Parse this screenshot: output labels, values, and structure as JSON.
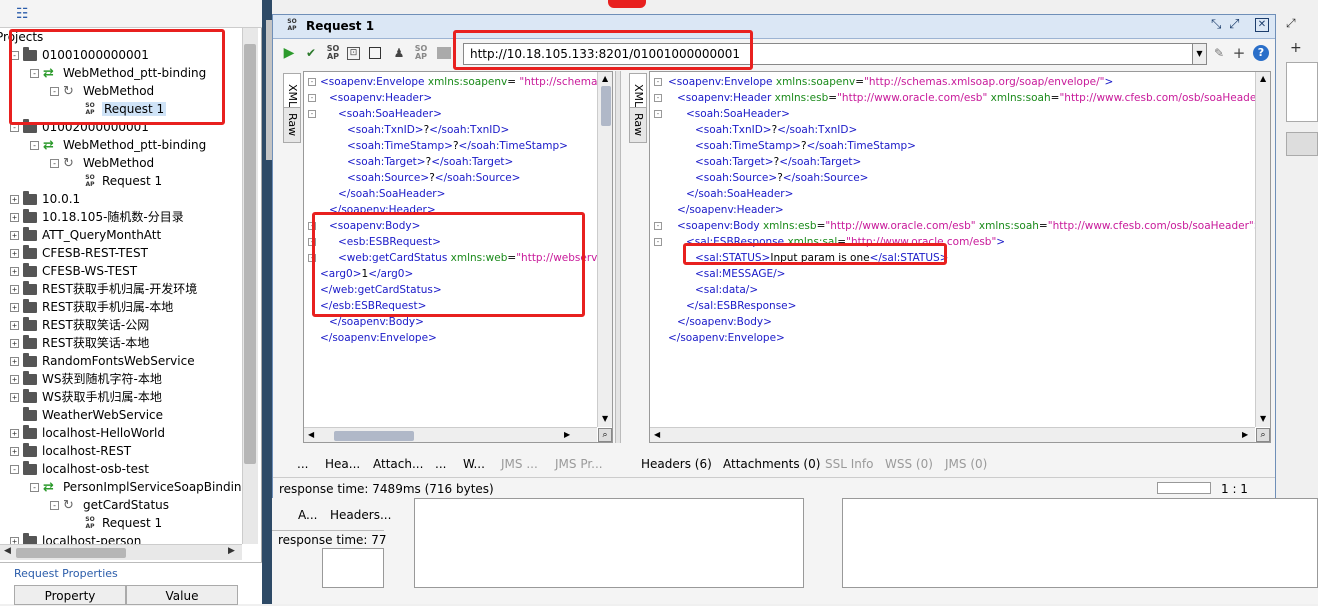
{
  "tree": {
    "projects_label": "Projects",
    "items": [
      {
        "label": "01001000000001",
        "kind": "project",
        "expander": "-",
        "indent": 0
      },
      {
        "label": "WebMethod_ptt-binding",
        "kind": "binding",
        "expander": "-",
        "indent": 1
      },
      {
        "label": "WebMethod",
        "kind": "method",
        "expander": "-",
        "indent": 2
      },
      {
        "label": "Request 1",
        "kind": "request",
        "expander": "",
        "indent": 3,
        "selected": true
      },
      {
        "label": "01002000000001",
        "kind": "project",
        "expander": "-",
        "indent": 0
      },
      {
        "label": "WebMethod_ptt-binding",
        "kind": "binding",
        "expander": "-",
        "indent": 1
      },
      {
        "label": "WebMethod",
        "kind": "method",
        "expander": "-",
        "indent": 2
      },
      {
        "label": "Request 1",
        "kind": "request",
        "expander": "",
        "indent": 3
      },
      {
        "label": "10.0.1",
        "kind": "project",
        "expander": "+",
        "indent": 0
      },
      {
        "label": "10.18.105-随机数-分目录",
        "kind": "project",
        "expander": "+",
        "indent": 0
      },
      {
        "label": "ATT_QueryMonthAtt",
        "kind": "project",
        "expander": "+",
        "indent": 0
      },
      {
        "label": "CFESB-REST-TEST",
        "kind": "project",
        "expander": "+",
        "indent": 0
      },
      {
        "label": "CFESB-WS-TEST",
        "kind": "project",
        "expander": "+",
        "indent": 0
      },
      {
        "label": "REST获取手机归属-开发环境",
        "kind": "project",
        "expander": "+",
        "indent": 0
      },
      {
        "label": "REST获取手机归属-本地",
        "kind": "project",
        "expander": "+",
        "indent": 0
      },
      {
        "label": "REST获取笑话-公网",
        "kind": "project",
        "expander": "+",
        "indent": 0
      },
      {
        "label": "REST获取笑话-本地",
        "kind": "project",
        "expander": "+",
        "indent": 0
      },
      {
        "label": "RandomFontsWebService",
        "kind": "project",
        "expander": "+",
        "indent": 0
      },
      {
        "label": "WS获到随机字符-本地",
        "kind": "project",
        "expander": "+",
        "indent": 0
      },
      {
        "label": "WS获取手机归属-本地",
        "kind": "project",
        "expander": "+",
        "indent": 0
      },
      {
        "label": "WeatherWebService",
        "kind": "project",
        "expander": "",
        "indent": 0
      },
      {
        "label": "localhost-HelloWorld",
        "kind": "project",
        "expander": "+",
        "indent": 0
      },
      {
        "label": "localhost-REST",
        "kind": "project",
        "expander": "+",
        "indent": 0
      },
      {
        "label": "localhost-osb-test",
        "kind": "project",
        "expander": "-",
        "indent": 0
      },
      {
        "label": "PersonImplServiceSoapBindin",
        "kind": "binding",
        "expander": "-",
        "indent": 1
      },
      {
        "label": "getCardStatus",
        "kind": "method",
        "expander": "-",
        "indent": 2
      },
      {
        "label": "Request 1",
        "kind": "request",
        "expander": "",
        "indent": 3
      },
      {
        "label": "localhost-person",
        "kind": "project",
        "expander": "+",
        "indent": 0
      }
    ]
  },
  "properties": {
    "title": "Request Properties",
    "col_property": "Property",
    "col_value": "Value"
  },
  "request": {
    "title": "Request 1",
    "url": "http://10.18.105.133:8201/01001000000001",
    "tab_xml": "XML",
    "tab_raw": "Raw",
    "request_lines": [
      {
        "fold": "-",
        "depth": 0,
        "parts": [
          [
            "t",
            "<soapenv:Envelope "
          ],
          [
            "a",
            "xmlns:soapenv"
          ],
          [
            "x",
            "= "
          ],
          [
            "v",
            "\"http://schemas.xmls"
          ]
        ]
      },
      {
        "fold": "-",
        "depth": 1,
        "parts": [
          [
            "t",
            "<soapenv:Header>"
          ]
        ]
      },
      {
        "fold": "-",
        "depth": 2,
        "parts": [
          [
            "t",
            "<soah:SoaHeader>"
          ]
        ]
      },
      {
        "fold": "",
        "depth": 3,
        "parts": [
          [
            "t",
            "<soah:TxnID>"
          ],
          [
            "x",
            "?"
          ],
          [
            "t",
            "</soah:TxnID>"
          ]
        ]
      },
      {
        "fold": "",
        "depth": 3,
        "parts": [
          [
            "t",
            "<soah:TimeStamp>"
          ],
          [
            "x",
            "?"
          ],
          [
            "t",
            "</soah:TimeStamp>"
          ]
        ]
      },
      {
        "fold": "",
        "depth": 3,
        "parts": [
          [
            "t",
            "<soah:Target>"
          ],
          [
            "x",
            "?"
          ],
          [
            "t",
            "</soah:Target>"
          ]
        ]
      },
      {
        "fold": "",
        "depth": 3,
        "parts": [
          [
            "t",
            "<soah:Source>"
          ],
          [
            "x",
            "?"
          ],
          [
            "t",
            "</soah:Source>"
          ]
        ]
      },
      {
        "fold": "",
        "depth": 2,
        "parts": [
          [
            "t",
            "</soah:SoaHeader>"
          ]
        ]
      },
      {
        "fold": "",
        "depth": 1,
        "parts": [
          [
            "t",
            "</soapenv:Header>"
          ]
        ]
      },
      {
        "fold": "-",
        "depth": 1,
        "parts": [
          [
            "t",
            "<soapenv:Body>"
          ]
        ]
      },
      {
        "fold": "-",
        "depth": 2,
        "parts": [
          [
            "t",
            "<esb:ESBRequest>"
          ]
        ]
      },
      {
        "fold": "-",
        "depth": 2,
        "parts": [
          [
            "t",
            "<web:getCardStatus "
          ],
          [
            "a",
            "xmlns:web"
          ],
          [
            "x",
            "="
          ],
          [
            "v",
            "\"http://webservice.c"
          ]
        ]
      },
      {
        "fold": "",
        "depth": 0,
        "parts": [
          [
            "t",
            "<arg0>"
          ],
          [
            "x",
            "1"
          ],
          [
            "t",
            "</arg0>"
          ]
        ]
      },
      {
        "fold": "",
        "depth": 0,
        "parts": [
          [
            "t",
            "</web:getCardStatus>"
          ]
        ]
      },
      {
        "fold": "",
        "depth": 0,
        "parts": [
          [
            "t",
            "</esb:ESBRequest>"
          ]
        ]
      },
      {
        "fold": "",
        "depth": 1,
        "parts": [
          [
            "t",
            "</soapenv:Body>"
          ]
        ]
      },
      {
        "fold": "",
        "depth": 0,
        "parts": [
          [
            "t",
            "</soapenv:Envelope>"
          ]
        ]
      }
    ],
    "response_lines": [
      {
        "fold": "-",
        "depth": 0,
        "parts": [
          [
            "t",
            "<soapenv:Envelope "
          ],
          [
            "a",
            "xmlns:soapenv"
          ],
          [
            "x",
            "="
          ],
          [
            "v",
            "\"http://schemas.xmlsoap.org/soap/envelope/\""
          ],
          [
            "t",
            ">"
          ]
        ]
      },
      {
        "fold": "-",
        "depth": 1,
        "parts": [
          [
            "t",
            "<soapenv:Header "
          ],
          [
            "a",
            "xmlns:esb"
          ],
          [
            "x",
            "="
          ],
          [
            "v",
            "\"http://www.oracle.com/esb\" "
          ],
          [
            "a",
            "xmlns:soah"
          ],
          [
            "x",
            "="
          ],
          [
            "v",
            "\"http://www.cfesb.com/osb/soaHeader\""
          ],
          [
            "t",
            ">"
          ]
        ]
      },
      {
        "fold": "-",
        "depth": 2,
        "parts": [
          [
            "t",
            "<soah:SoaHeader>"
          ]
        ]
      },
      {
        "fold": "",
        "depth": 3,
        "parts": [
          [
            "t",
            "<soah:TxnID>"
          ],
          [
            "x",
            "?"
          ],
          [
            "t",
            "</soah:TxnID>"
          ]
        ]
      },
      {
        "fold": "",
        "depth": 3,
        "parts": [
          [
            "t",
            "<soah:TimeStamp>"
          ],
          [
            "x",
            "?"
          ],
          [
            "t",
            "</soah:TimeStamp>"
          ]
        ]
      },
      {
        "fold": "",
        "depth": 3,
        "parts": [
          [
            "t",
            "<soah:Target>"
          ],
          [
            "x",
            "?"
          ],
          [
            "t",
            "</soah:Target>"
          ]
        ]
      },
      {
        "fold": "",
        "depth": 3,
        "parts": [
          [
            "t",
            "<soah:Source>"
          ],
          [
            "x",
            "?"
          ],
          [
            "t",
            "</soah:Source>"
          ]
        ]
      },
      {
        "fold": "",
        "depth": 2,
        "parts": [
          [
            "t",
            "</soah:SoaHeader>"
          ]
        ]
      },
      {
        "fold": "",
        "depth": 1,
        "parts": [
          [
            "t",
            "</soapenv:Header>"
          ]
        ]
      },
      {
        "fold": "-",
        "depth": 1,
        "parts": [
          [
            "t",
            "<soapenv:Body "
          ],
          [
            "a",
            "xmlns:esb"
          ],
          [
            "x",
            "="
          ],
          [
            "v",
            "\"http://www.oracle.com/esb\" "
          ],
          [
            "a",
            "xmlns:soah"
          ],
          [
            "x",
            "="
          ],
          [
            "v",
            "\"http://www.cfesb.com/osb/soaHeader\""
          ],
          [
            "t",
            ">"
          ]
        ]
      },
      {
        "fold": "-",
        "depth": 2,
        "parts": [
          [
            "t",
            "<sal:ESBResponse "
          ],
          [
            "a",
            "xmlns:sal"
          ],
          [
            "x",
            "="
          ],
          [
            "v",
            "\"http://www.oracle.com/esb\""
          ],
          [
            "t",
            ">"
          ]
        ]
      },
      {
        "fold": "",
        "depth": 3,
        "parts": [
          [
            "t",
            "<sal:STATUS>"
          ],
          [
            "x",
            "Input param is one"
          ],
          [
            "t",
            "</sal:STATUS>"
          ]
        ]
      },
      {
        "fold": "",
        "depth": 3,
        "parts": [
          [
            "t",
            "<sal:MESSAGE/>"
          ]
        ]
      },
      {
        "fold": "",
        "depth": 3,
        "parts": [
          [
            "t",
            "<sal:data/>"
          ]
        ]
      },
      {
        "fold": "",
        "depth": 2,
        "parts": [
          [
            "t",
            "</sal:ESBResponse>"
          ]
        ]
      },
      {
        "fold": "",
        "depth": 1,
        "parts": [
          [
            "t",
            "</soapenv:Body>"
          ]
        ]
      },
      {
        "fold": "",
        "depth": 0,
        "parts": [
          [
            "t",
            "</soapenv:Envelope>"
          ]
        ]
      }
    ],
    "request_tabs": [
      {
        "label": "...",
        "disabled": false
      },
      {
        "label": "Hea...",
        "disabled": false
      },
      {
        "label": "Attach...",
        "disabled": false
      },
      {
        "label": "...",
        "disabled": false
      },
      {
        "label": "W...",
        "disabled": false
      },
      {
        "label": "JMS ...",
        "disabled": true
      },
      {
        "label": "JMS Pr...",
        "disabled": true
      }
    ],
    "response_tabs": [
      {
        "label": "Headers (6)",
        "disabled": false
      },
      {
        "label": "Attachments (0)",
        "disabled": false
      },
      {
        "label": "SSL Info",
        "disabled": true
      },
      {
        "label": "WSS (0)",
        "disabled": true
      },
      {
        "label": "JMS (0)",
        "disabled": true
      }
    ],
    "response_time": "response time: 7489ms (716 bytes)",
    "cursor_pos": "1 : 1"
  },
  "background": {
    "tab_a": "A...",
    "tab_headers": "Headers...",
    "response_time_partial": "response time: 77"
  },
  "colors": {
    "highlight_box": "#e8201f",
    "tag": "#1a1ac8",
    "attr": "#1a8a1a",
    "value": "#c81a9a"
  }
}
